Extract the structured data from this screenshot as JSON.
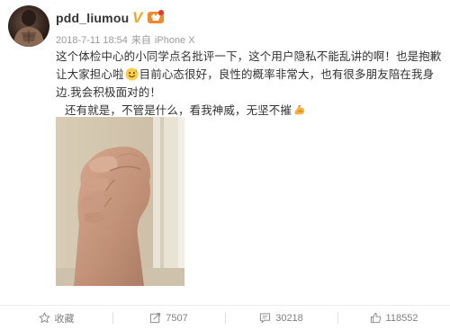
{
  "post": {
    "username": "pdd_liumou",
    "date": "2018-7-11 18:54",
    "source_prefix": "来自",
    "device": "iPhone X",
    "text_line1_part1": "这个体检中心的小同学点名批评一下，这个用户隐私不能乱讲的啊！也是抱歉让",
    "text_line1_part2": "大家担心啦",
    "text_line1_part3": "目前心态很好，良性的概率非常大，也有很多朋友陪在我身边.我会",
    "text_line1_part4": "积极面对的！",
    "text_line2": "还有就是，不管是什么，看我神威，无坚不摧",
    "emoji_1": "sweat-smile-icon",
    "emoji_2": "flexed-biceps-icon"
  },
  "actions": {
    "favorite_label": "收藏",
    "repost_count": "7507",
    "comment_count": "30218",
    "like_count": "118552"
  },
  "colors": {
    "text": "#333333",
    "meta": "#9a9a9a",
    "verified": "#f5a623",
    "action_text": "#808080"
  }
}
